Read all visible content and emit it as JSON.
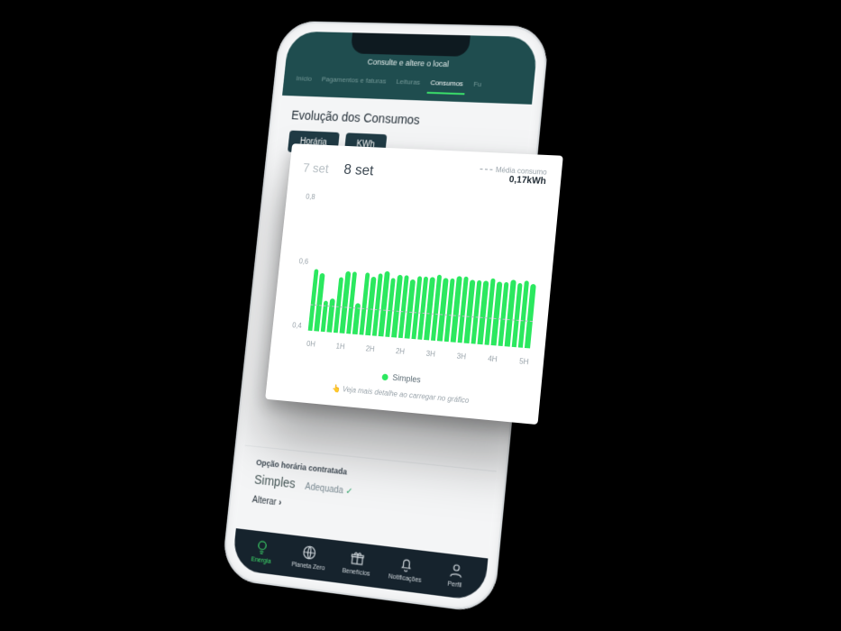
{
  "header": {
    "title": "Consulte e altere o local",
    "tabs": [
      "Início",
      "Pagamentos e faturas",
      "Leituras",
      "Consumos",
      "Fu"
    ],
    "active_tab_index": 3
  },
  "section": {
    "title": "Evolução dos Consumos",
    "pill_period": "Horária",
    "pill_unit": "KWh"
  },
  "tariff": {
    "label": "Opção horária contratada",
    "value": "Simples",
    "status": "Adequada",
    "change_label": "Alterar"
  },
  "navbar": {
    "items": [
      {
        "label": "Energia",
        "icon": "bulb",
        "active": true
      },
      {
        "label": "Planeta Zero",
        "icon": "globe",
        "active": false
      },
      {
        "label": "Benefícios",
        "icon": "gift",
        "active": false
      },
      {
        "label": "Notificações",
        "icon": "bell",
        "active": false
      },
      {
        "label": "Perfil",
        "icon": "user",
        "active": false
      }
    ]
  },
  "chart_card": {
    "date_inactive": "7 set",
    "date_active": "8 set",
    "avg_label": "Média consumo",
    "avg_value_text": "0,17kWh",
    "legend_label": "Simples",
    "hint": "Veja mais detalhe ao carregar no gráfico"
  },
  "chart_data": {
    "type": "bar",
    "title": "Evolução dos Consumos",
    "xlabel": "",
    "ylabel": "kWh",
    "ylim": [
      0,
      0.9
    ],
    "y_ticks": [
      0.8,
      0.6,
      0.4
    ],
    "x_tick_labels": [
      "0H",
      "1H",
      "2H",
      "2H",
      "3H",
      "3H",
      "4H",
      "5H"
    ],
    "avg": 0.17,
    "series": [
      {
        "name": "Simples",
        "color": "#2be85f",
        "values": [
          0.4,
          0.38,
          0.2,
          0.22,
          0.36,
          0.4,
          0.4,
          0.2,
          0.4,
          0.38,
          0.4,
          0.42,
          0.38,
          0.4,
          0.4,
          0.38,
          0.4,
          0.4,
          0.4,
          0.42,
          0.4,
          0.4,
          0.42,
          0.42,
          0.4,
          0.4,
          0.4,
          0.42,
          0.4,
          0.4,
          0.42,
          0.4,
          0.42,
          0.4
        ]
      }
    ]
  }
}
